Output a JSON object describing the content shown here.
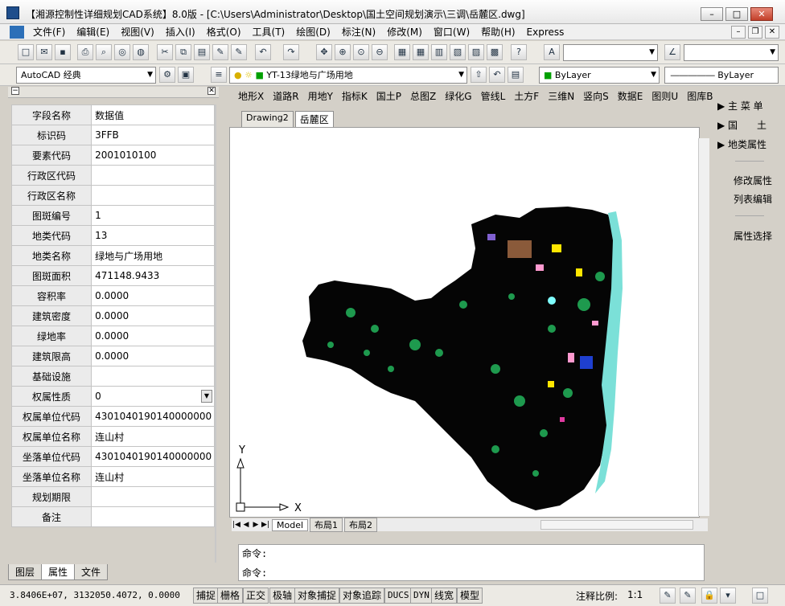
{
  "app": {
    "title": "【湘源控制性详细规划CAD系统】8.0版 - [C:\\Users\\Administrator\\Desktop\\国土空间规划演示\\三调\\岳麓区.dwg]"
  },
  "menu": [
    "文件(F)",
    "编辑(E)",
    "视图(V)",
    "插入(I)",
    "格式(O)",
    "工具(T)",
    "绘图(D)",
    "标注(N)",
    "修改(M)",
    "窗口(W)",
    "帮助(H)",
    "Express"
  ],
  "toolbar": {
    "workspace": "AutoCAD 经典",
    "layer_value": "YT-13绿地与广场用地",
    "color_value": "ByLayer",
    "linetype_value": "ByLayer"
  },
  "window_buttons": {
    "minimize": "–",
    "maximize": "□",
    "close": "✕",
    "mdi_min": "–",
    "mdi_restore": "❐",
    "mdi_close": "✕"
  },
  "panel": {
    "collapse": "−",
    "close": "✕"
  },
  "properties": [
    {
      "k": "字段名称",
      "v": "数据值"
    },
    {
      "k": "标识码",
      "v": "3FFB"
    },
    {
      "k": "要素代码",
      "v": "2001010100"
    },
    {
      "k": "行政区代码",
      "v": ""
    },
    {
      "k": "行政区名称",
      "v": ""
    },
    {
      "k": "图斑编号",
      "v": "1"
    },
    {
      "k": "地类代码",
      "v": "13"
    },
    {
      "k": "地类名称",
      "v": "绿地与广场用地"
    },
    {
      "k": "图斑面积",
      "v": "471148.9433"
    },
    {
      "k": "容积率",
      "v": "0.0000"
    },
    {
      "k": "建筑密度",
      "v": "0.0000"
    },
    {
      "k": "绿地率",
      "v": "0.0000"
    },
    {
      "k": "建筑限高",
      "v": "0.0000"
    },
    {
      "k": "基础设施",
      "v": ""
    },
    {
      "k": "权属性质",
      "v": "0"
    },
    {
      "k": "权属单位代码",
      "v": "430104019014000000​0"
    },
    {
      "k": "权属单位名称",
      "v": "连山村"
    },
    {
      "k": "坐落单位代码",
      "v": "430104019014000000​0"
    },
    {
      "k": "坐落单位名称",
      "v": "连山村"
    },
    {
      "k": "规划期限",
      "v": ""
    },
    {
      "k": "备注",
      "v": ""
    }
  ],
  "bottom_tabs": [
    "图层",
    "属性",
    "文件"
  ],
  "layer_menu": [
    "地形X",
    "道路R",
    "用地Y",
    "指标K",
    "国土P",
    "总图Z",
    "绿化G",
    "管线L",
    "土方F",
    "三维N",
    "竖向S",
    "数据E",
    "图则U",
    "图库B"
  ],
  "drawing_tabs": [
    "Drawing2",
    "岳麓区"
  ],
  "layout_tabs": [
    "Model",
    "布局1",
    "布局2"
  ],
  "command": {
    "line1": "命令:",
    "line2": "命令:"
  },
  "axis": {
    "x": "X",
    "y": "Y"
  },
  "right_panel": {
    "items": [
      "主 菜 单",
      "国　　土",
      "地类属性",
      "修改属性",
      "列表编辑",
      "属性选择"
    ]
  },
  "status": {
    "coords": "3.8406E+07, 3132050.4072, 0.0000",
    "buttons": [
      "捕捉",
      "栅格",
      "正交",
      "极轴",
      "对象捕捉",
      "对象追踪",
      "DUCS",
      "DYN",
      "线宽",
      "模型"
    ],
    "scale_label": "注释比例:",
    "scale_value": "1:1"
  }
}
